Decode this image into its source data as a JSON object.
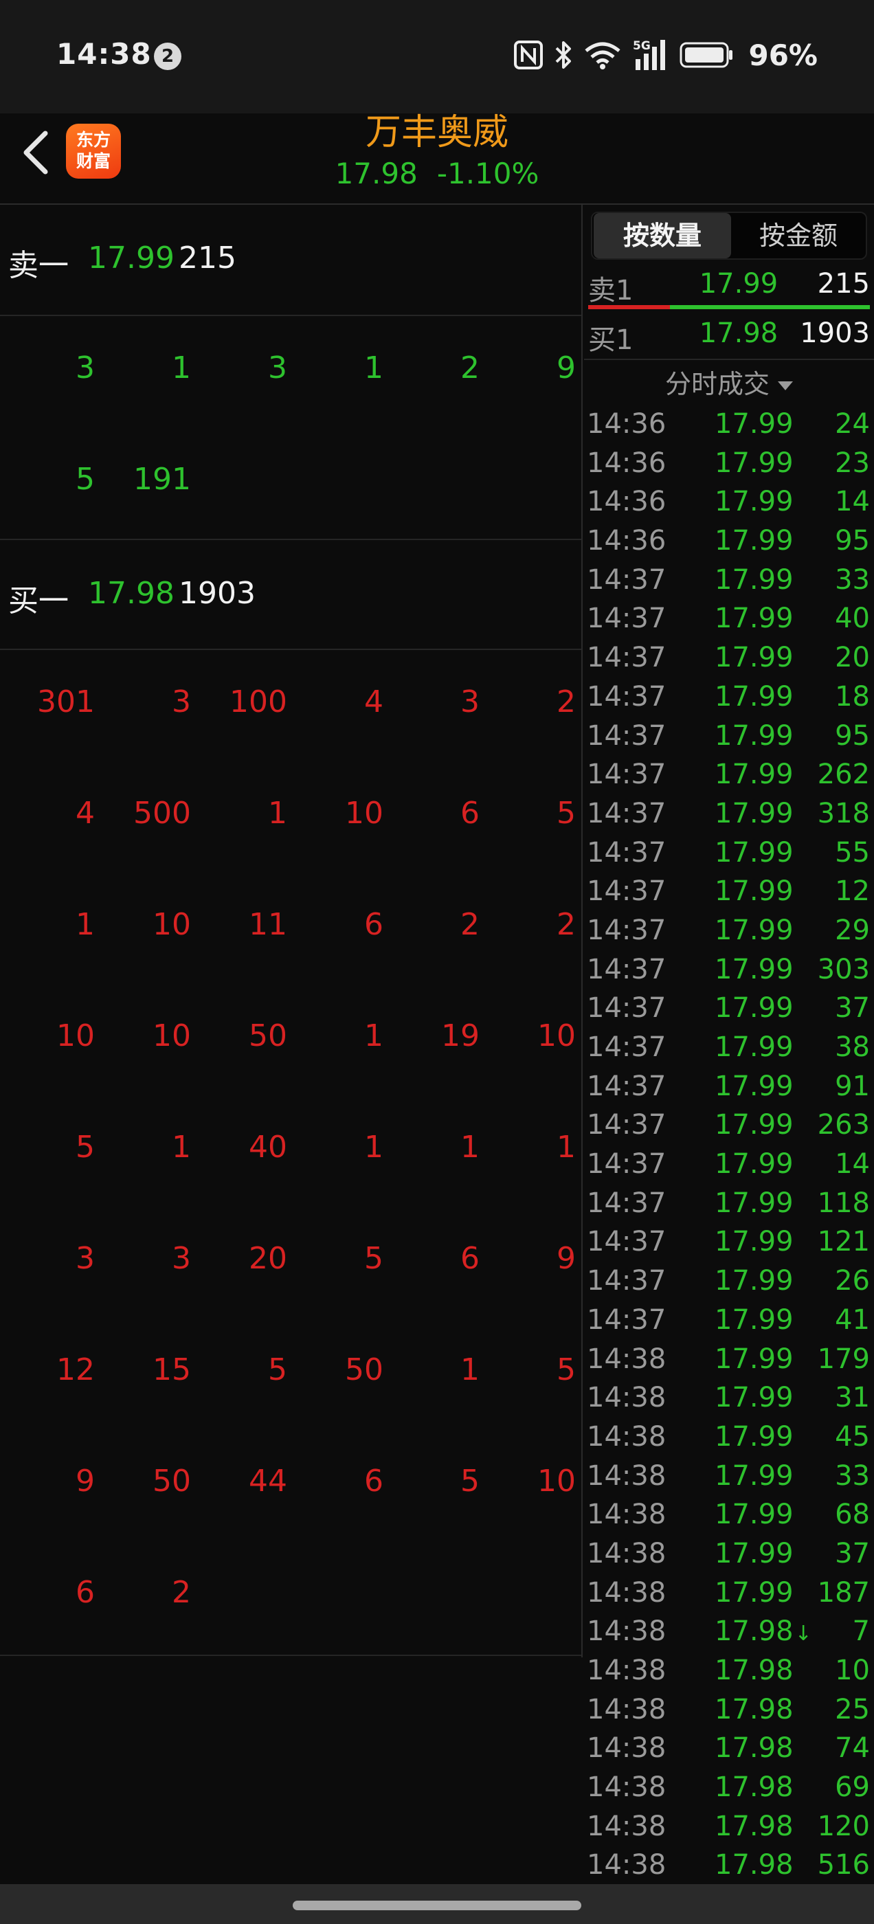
{
  "status_bar": {
    "time": "14:38",
    "notification_count": "2",
    "network": "5G",
    "battery": "96%"
  },
  "header": {
    "logo_line1": "东方",
    "logo_line2": "财富",
    "stock_name": "万丰奥威",
    "price": "17.98",
    "change_pct": "-1.10%"
  },
  "sell_queue": {
    "label": "卖一",
    "price": "17.99",
    "total": "215",
    "orders": [
      [
        "3",
        "1",
        "3",
        "1",
        "2",
        "9"
      ],
      [
        "5",
        "191"
      ]
    ]
  },
  "buy_queue": {
    "label": "买一",
    "price": "17.98",
    "total": "1903",
    "orders": [
      [
        "301",
        "3",
        "100",
        "4",
        "3",
        "2"
      ],
      [
        "4",
        "500",
        "1",
        "10",
        "6",
        "5"
      ],
      [
        "1",
        "10",
        "11",
        "6",
        "2",
        "2"
      ],
      [
        "10",
        "10",
        "50",
        "1",
        "19",
        "10"
      ],
      [
        "5",
        "1",
        "40",
        "1",
        "1",
        "1"
      ],
      [
        "3",
        "3",
        "20",
        "5",
        "6",
        "9"
      ],
      [
        "12",
        "15",
        "5",
        "50",
        "1",
        "5"
      ],
      [
        "9",
        "50",
        "44",
        "6",
        "5",
        "10"
      ],
      [
        "6",
        "2"
      ]
    ]
  },
  "trade_panel": {
    "tab_quantity": "按数量",
    "tab_amount": "按金额",
    "ask1": {
      "label": "卖1",
      "price": "17.99",
      "volume": "215"
    },
    "bid1": {
      "label": "买1",
      "price": "17.98",
      "volume": "1903"
    },
    "ratio_sell_fraction": 0.29,
    "section_title": "分时成交",
    "trades": [
      {
        "time": "14:36",
        "price": "17.99",
        "volume": "24"
      },
      {
        "time": "14:36",
        "price": "17.99",
        "volume": "23"
      },
      {
        "time": "14:36",
        "price": "17.99",
        "volume": "14"
      },
      {
        "time": "14:36",
        "price": "17.99",
        "volume": "95"
      },
      {
        "time": "14:37",
        "price": "17.99",
        "volume": "33"
      },
      {
        "time": "14:37",
        "price": "17.99",
        "volume": "40"
      },
      {
        "time": "14:37",
        "price": "17.99",
        "volume": "20"
      },
      {
        "time": "14:37",
        "price": "17.99",
        "volume": "18"
      },
      {
        "time": "14:37",
        "price": "17.99",
        "volume": "95"
      },
      {
        "time": "14:37",
        "price": "17.99",
        "volume": "262"
      },
      {
        "time": "14:37",
        "price": "17.99",
        "volume": "318"
      },
      {
        "time": "14:37",
        "price": "17.99",
        "volume": "55"
      },
      {
        "time": "14:37",
        "price": "17.99",
        "volume": "12"
      },
      {
        "time": "14:37",
        "price": "17.99",
        "volume": "29"
      },
      {
        "time": "14:37",
        "price": "17.99",
        "volume": "303"
      },
      {
        "time": "14:37",
        "price": "17.99",
        "volume": "37"
      },
      {
        "time": "14:37",
        "price": "17.99",
        "volume": "38"
      },
      {
        "time": "14:37",
        "price": "17.99",
        "volume": "91"
      },
      {
        "time": "14:37",
        "price": "17.99",
        "volume": "263"
      },
      {
        "time": "14:37",
        "price": "17.99",
        "volume": "14"
      },
      {
        "time": "14:37",
        "price": "17.99",
        "volume": "118"
      },
      {
        "time": "14:37",
        "price": "17.99",
        "volume": "121"
      },
      {
        "time": "14:37",
        "price": "17.99",
        "volume": "26"
      },
      {
        "time": "14:37",
        "price": "17.99",
        "volume": "41"
      },
      {
        "time": "14:38",
        "price": "17.99",
        "volume": "179"
      },
      {
        "time": "14:38",
        "price": "17.99",
        "volume": "31"
      },
      {
        "time": "14:38",
        "price": "17.99",
        "volume": "45"
      },
      {
        "time": "14:38",
        "price": "17.99",
        "volume": "33"
      },
      {
        "time": "14:38",
        "price": "17.99",
        "volume": "68"
      },
      {
        "time": "14:38",
        "price": "17.99",
        "volume": "37"
      },
      {
        "time": "14:38",
        "price": "17.99",
        "volume": "187"
      },
      {
        "time": "14:38",
        "price": "17.98",
        "volume": "7",
        "arrow": "↓"
      },
      {
        "time": "14:38",
        "price": "17.98",
        "volume": "10"
      },
      {
        "time": "14:38",
        "price": "17.98",
        "volume": "25"
      },
      {
        "time": "14:38",
        "price": "17.98",
        "volume": "74"
      },
      {
        "time": "14:38",
        "price": "17.98",
        "volume": "69"
      },
      {
        "time": "14:38",
        "price": "17.98",
        "volume": "120"
      },
      {
        "time": "14:38",
        "price": "17.98",
        "volume": "516"
      }
    ]
  },
  "colors": {
    "up_green": "#2ec22e",
    "down_red": "#d82222",
    "accent_orange": "#f09a1a"
  }
}
